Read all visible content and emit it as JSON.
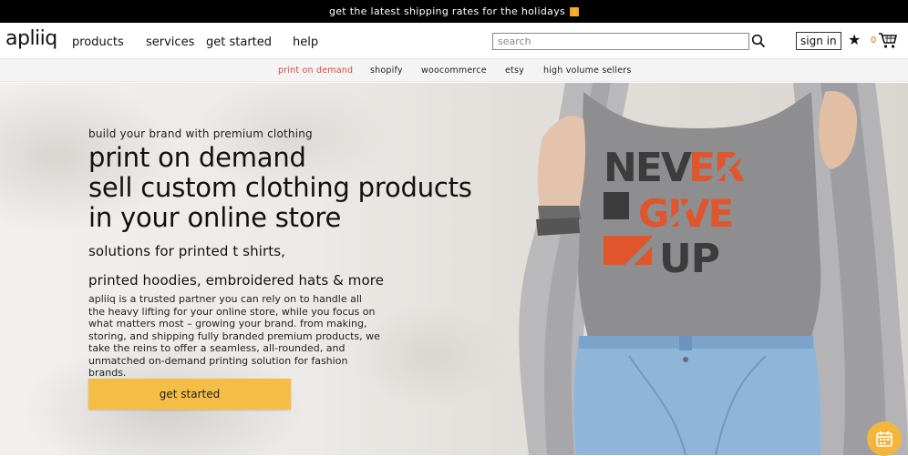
{
  "announcement": {
    "text": "get the latest shipping rates for the holidays"
  },
  "header": {
    "logo": "apliiq",
    "nav": [
      "products",
      "services",
      "get started",
      "help"
    ],
    "search_placeholder": "search",
    "sign_in": "sign in",
    "cart_count": "0"
  },
  "subnav": {
    "items": [
      "print on demand",
      "shopify",
      "woocommerce",
      "etsy",
      "high volume sellers"
    ],
    "active": "print on demand"
  },
  "hero": {
    "kicker": "build your brand with premium clothing",
    "headline": [
      "print on demand",
      "sell custom clothing products",
      "in your online store"
    ],
    "sub1": "solutions for printed t shirts,",
    "sub2": "printed hoodies, embroidered hats & more",
    "body": "apliiq is a trusted partner you can rely on to handle all the heavy lifting for your online store, while you focus on what matters most – growing your brand. from making, storing, and shipping fully branded premium products, we take the reins to offer a seamless, all-rounded, and unmatched on-demand printing solution for fashion brands.",
    "cta": "get started",
    "shirt_print": [
      "NEVER",
      "GIVE",
      "UP"
    ]
  },
  "colors": {
    "accent": "#f4bd45",
    "active_subnav": "#d9473a",
    "shirt_print_orange": "#e0552c"
  }
}
